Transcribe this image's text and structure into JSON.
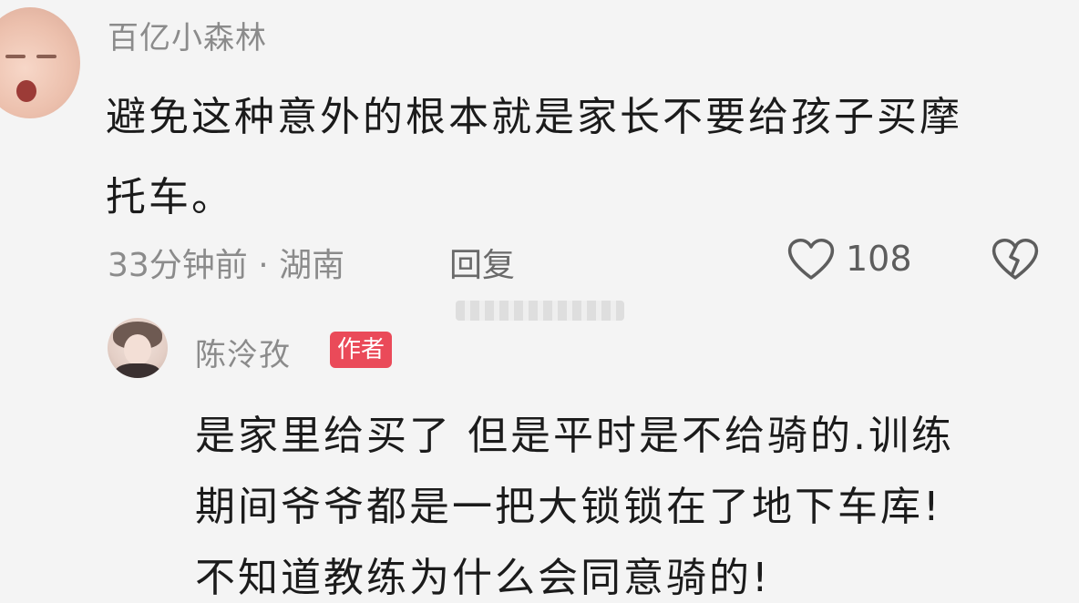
{
  "comment": {
    "username": "百亿小森林",
    "text_line1": "避免这种意外的根本就是家长不要给孩子买摩",
    "text_line2": "托车。",
    "meta": "33分钟前 · 湖南",
    "reply_label": "回复",
    "like_count": "108"
  },
  "reply": {
    "username": "陈泠孜",
    "badge": "作者",
    "text_line1": "是家里给买了 但是平时是不给骑的.训练",
    "text_line2": "期间爷爷都是一把大锁锁在了地下车库!",
    "text_line3": "不知道教练为什么会同意骑的!"
  },
  "icons": {
    "like": "heart-outline-icon",
    "dislike": "broken-heart-icon"
  },
  "colors": {
    "background": "#f4f4f4",
    "author_badge": "#ea4a59"
  }
}
